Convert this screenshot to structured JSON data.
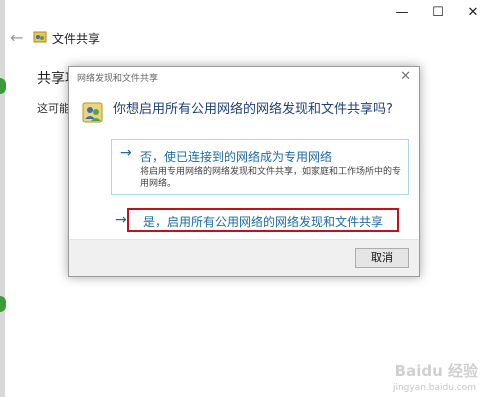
{
  "window": {
    "title": "文件共享",
    "minimize": "—",
    "maximize": "☐",
    "close": "✕",
    "back": "←",
    "background_heading": "共享项",
    "background_text": "这可能是"
  },
  "dialog": {
    "title": "网络发现和文件共享",
    "close": "✕",
    "question": "你想启用所有公用网络的网络发现和文件共享吗?",
    "option1_arrow": "→",
    "option1_label": "否，使已连接到的网络成为专用网络",
    "option1_description": "将启用专用网络的网络发现和文件共享，如家庭和工作场所中的专用网络。",
    "option2_arrow": "→",
    "option2_label": "是，启用所有公用网络的网络发现和文件共享",
    "cancel": "取消",
    "highlight_color": "#c0121d",
    "link_color": "#1c6aa8"
  },
  "watermark": {
    "text": "Baidu 经验",
    "sub": "jingyan.baidu.com"
  },
  "icons": [
    "back-arrow-icon",
    "network-share-icon",
    "users-icon",
    "close-icon",
    "arrow-right-icon"
  ]
}
